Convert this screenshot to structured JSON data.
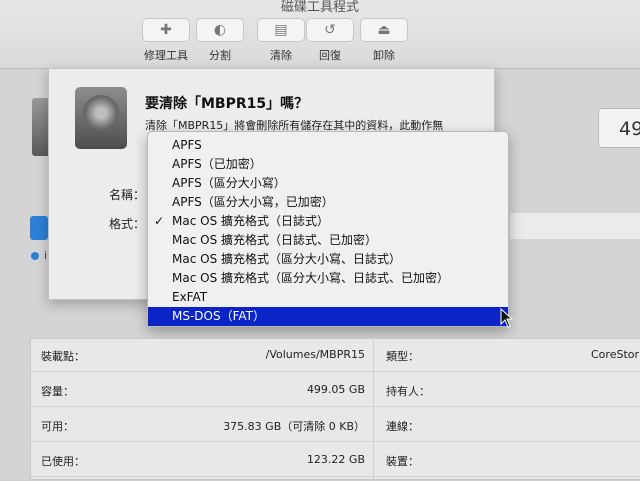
{
  "app": {
    "title": "磁碟工具程式"
  },
  "toolbar": {
    "items": [
      {
        "label": "修理工具",
        "icon": "first-aid-icon"
      },
      {
        "label": "分割",
        "icon": "partition-icon"
      },
      {
        "label": "清除",
        "icon": "erase-icon"
      },
      {
        "label": "回復",
        "icon": "restore-icon"
      },
      {
        "label": "卸除",
        "icon": "unmount-icon"
      }
    ]
  },
  "background": {
    "capacity_partial": "49",
    "row_partial": "i"
  },
  "sheet": {
    "title": "要清除「MBPR15」嗎？",
    "description": "清除「MBPR15」將會刪除所有儲存在其中的資料，此動作無",
    "name_label": "名稱：",
    "format_label": "格式："
  },
  "format_menu": {
    "items": [
      {
        "label": "APFS",
        "checked": false,
        "highlighted": false
      },
      {
        "label": "APFS（已加密）",
        "checked": false,
        "highlighted": false
      },
      {
        "label": "APFS（區分大小寫）",
        "checked": false,
        "highlighted": false
      },
      {
        "label": "APFS（區分大小寫，已加密）",
        "checked": false,
        "highlighted": false
      },
      {
        "label": "Mac OS 擴充格式（日誌式）",
        "checked": true,
        "highlighted": false
      },
      {
        "label": "Mac OS 擴充格式（日誌式、已加密）",
        "checked": false,
        "highlighted": false
      },
      {
        "label": "Mac OS 擴充格式（區分大小寫、日誌式）",
        "checked": false,
        "highlighted": false
      },
      {
        "label": "Mac OS 擴充格式（區分大小寫、日誌式、已加密）",
        "checked": false,
        "highlighted": false
      },
      {
        "label": "ExFAT",
        "checked": false,
        "highlighted": false
      },
      {
        "label": "MS-DOS（FAT）",
        "checked": false,
        "highlighted": true
      }
    ],
    "checkmark": "✓",
    "highlight_color": "#0a24c8"
  },
  "info": {
    "rows": [
      {
        "k1": "裝載點：",
        "v1": "/Volumes/MBPR15",
        "k2": "類型：",
        "v2": "CoreStor"
      },
      {
        "k1": "容量：",
        "v1": "499.05 GB",
        "k2": "持有人：",
        "v2": ""
      },
      {
        "k1": "可用：",
        "v1": "375.83 GB（可清除 0 KB）",
        "k2": "連線：",
        "v2": ""
      },
      {
        "k1": "已使用：",
        "v1": "123.22 GB",
        "k2": "裝置：",
        "v2": ""
      }
    ]
  }
}
